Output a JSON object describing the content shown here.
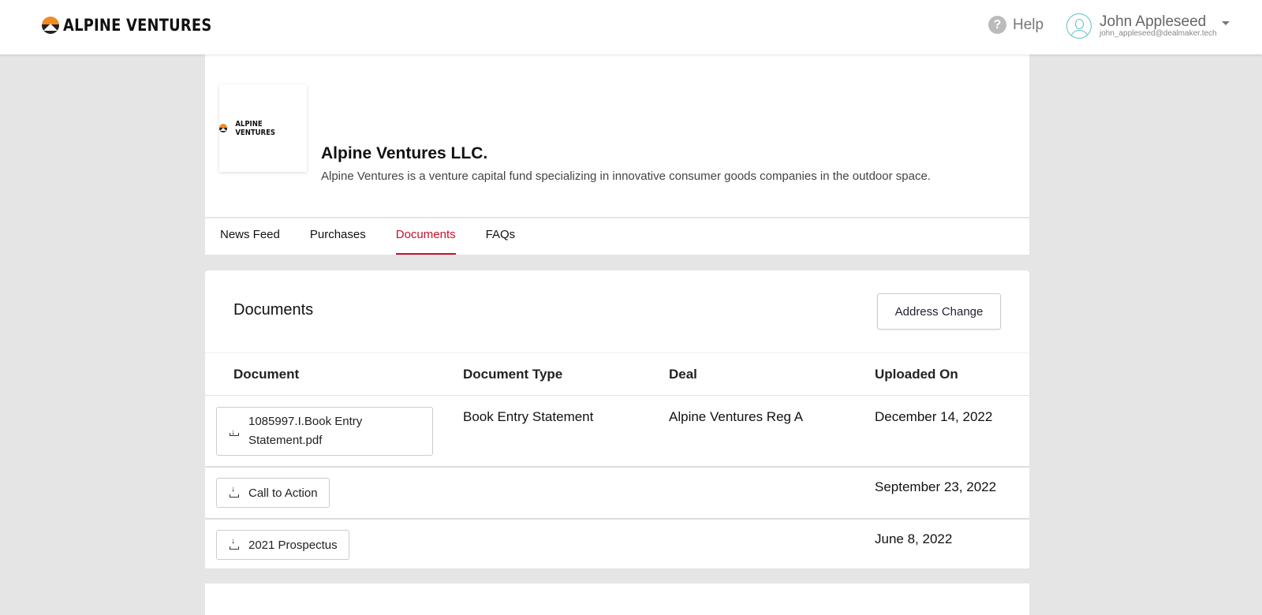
{
  "header": {
    "brand": "ALPINE VENTURES",
    "help": "Help",
    "user_name": "John Appleseed",
    "user_email": "john_appleseed@dealmaker.tech"
  },
  "profile": {
    "logo_text": "ALPINE VENTURES",
    "name": "Alpine Ventures LLC.",
    "description": "Alpine Ventures is a venture capital fund specializing in innovative consumer goods companies in the outdoor space."
  },
  "tabs": [
    {
      "label": "News Feed"
    },
    {
      "label": "Purchases"
    },
    {
      "label": "Documents",
      "active": true
    },
    {
      "label": "FAQs"
    }
  ],
  "documents": {
    "title": "Documents",
    "address_change": "Address Change",
    "columns": [
      "Document",
      "Document Type",
      "Deal",
      "Uploaded On"
    ],
    "rows": [
      {
        "file_line1": "1085997.I.Book Entry",
        "file_line2": "Statement.pdf",
        "type": "Book Entry Statement",
        "deal": "Alpine Ventures Reg A",
        "uploaded": "December 14, 2022"
      },
      {
        "file_line1": "Call to Action",
        "type": "",
        "deal": "",
        "uploaded": "September 23, 2022"
      },
      {
        "file_line1": "2021 Prospectus",
        "type": "",
        "deal": "",
        "uploaded": "June 8, 2022"
      }
    ]
  },
  "colors": {
    "accent": "#c8102e",
    "avatar": "#5cc2bd"
  }
}
